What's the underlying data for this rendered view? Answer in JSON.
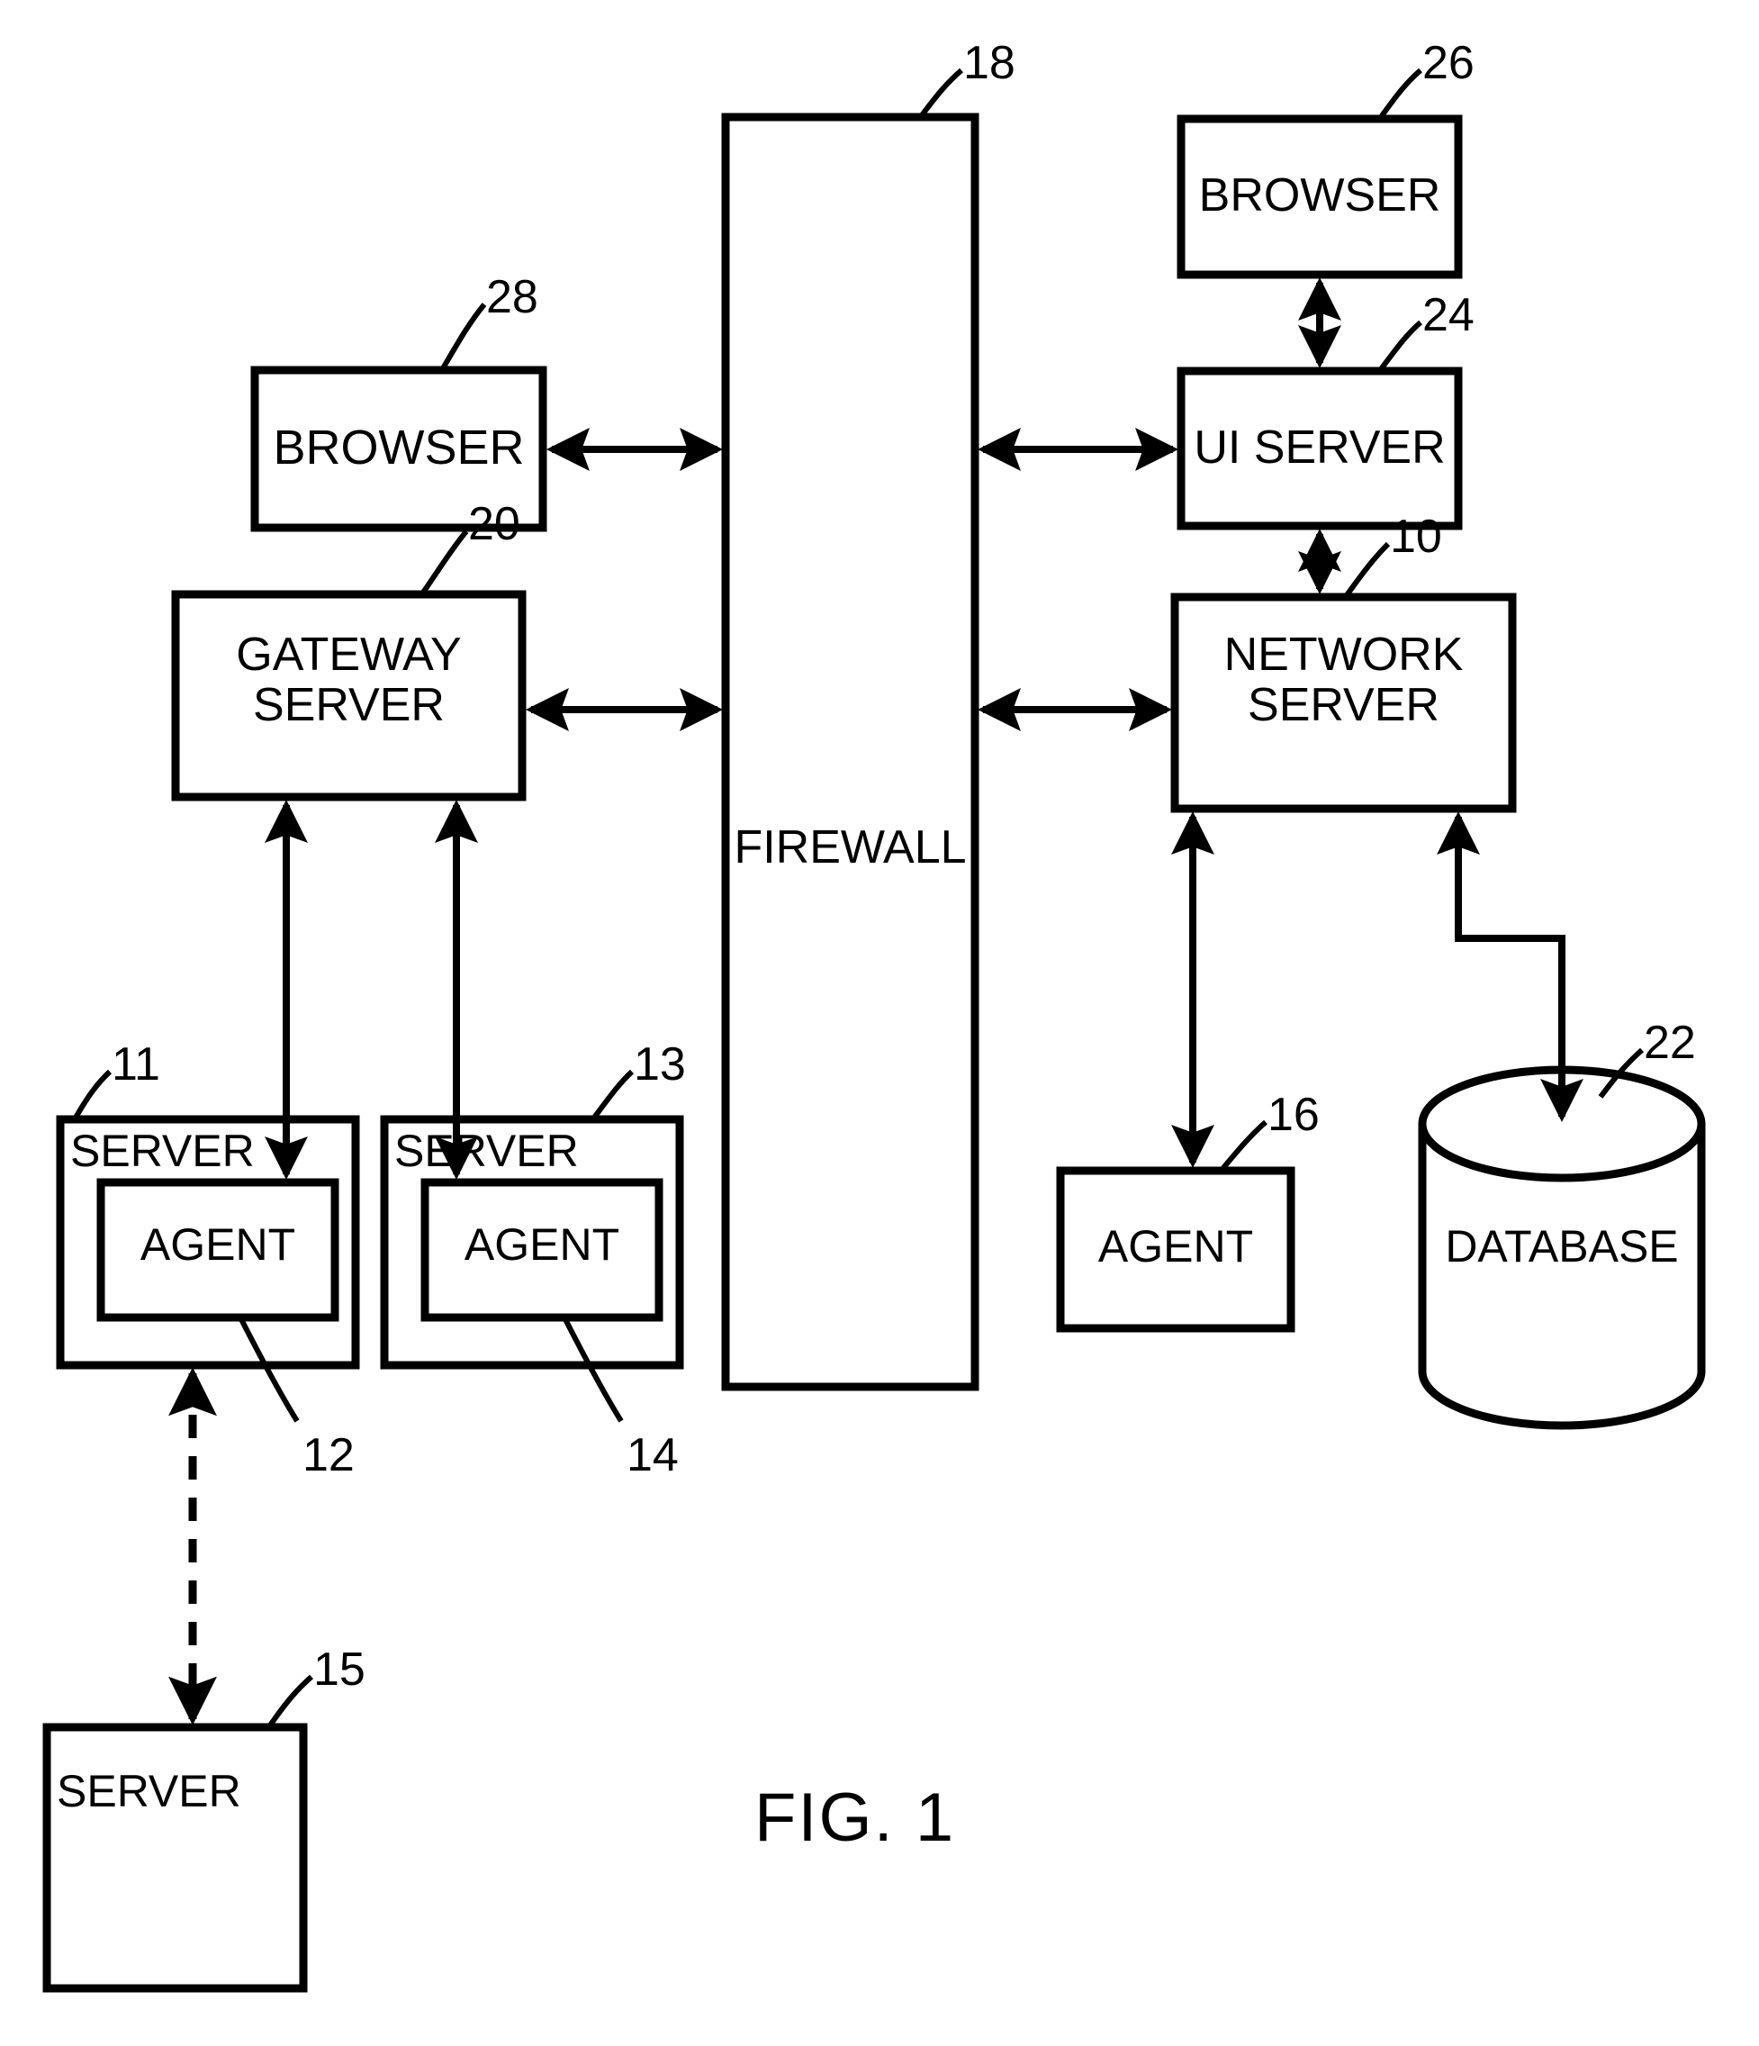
{
  "figure": {
    "caption": "FIG. 1",
    "title": "Network monitoring system block diagram"
  },
  "nodes": {
    "browser_left": {
      "label": "BROWSER",
      "ref": "28",
      "shape": "rectangle"
    },
    "gateway_server": {
      "label": "GATEWAY\nSERVER",
      "ref": "20",
      "shape": "rectangle"
    },
    "firewall": {
      "label": "FIREWALL",
      "ref": "18",
      "shape": "tall-rectangle"
    },
    "browser_right": {
      "label": "BROWSER",
      "ref": "26",
      "shape": "rectangle"
    },
    "ui_server": {
      "label": "UI SERVER",
      "ref": "24",
      "shape": "rectangle"
    },
    "network_server": {
      "label": "NETWORK\nSERVER",
      "ref": "10",
      "shape": "rectangle"
    },
    "server_11": {
      "label": "SERVER",
      "ref": "11",
      "shape": "rectangle"
    },
    "agent_12": {
      "label": "AGENT",
      "ref": "12",
      "shape": "rectangle"
    },
    "server_13": {
      "label": "SERVER",
      "ref": "13",
      "shape": "rectangle"
    },
    "agent_14": {
      "label": "AGENT",
      "ref": "14",
      "shape": "rectangle"
    },
    "agent_16": {
      "label": "AGENT",
      "ref": "16",
      "shape": "rectangle"
    },
    "database_22": {
      "label": "DATABASE",
      "ref": "22",
      "shape": "cylinder"
    },
    "server_15": {
      "label": "SERVER",
      "ref": "15",
      "shape": "rectangle"
    }
  },
  "connections": [
    {
      "from": "browser_left",
      "to": "firewall",
      "style": "solid",
      "arrows": "both"
    },
    {
      "from": "gateway_server",
      "to": "firewall",
      "style": "solid",
      "arrows": "both"
    },
    {
      "from": "firewall",
      "to": "ui_server",
      "style": "solid",
      "arrows": "both"
    },
    {
      "from": "firewall",
      "to": "network_server",
      "style": "solid",
      "arrows": "both"
    },
    {
      "from": "browser_right",
      "to": "ui_server",
      "style": "solid",
      "arrows": "both"
    },
    {
      "from": "ui_server",
      "to": "network_server",
      "style": "solid",
      "arrows": "both"
    },
    {
      "from": "gateway_server",
      "to": "agent_12",
      "style": "solid",
      "arrows": "both"
    },
    {
      "from": "gateway_server",
      "to": "agent_14",
      "style": "solid",
      "arrows": "both"
    },
    {
      "from": "network_server",
      "to": "agent_16",
      "style": "solid",
      "arrows": "both"
    },
    {
      "from": "network_server",
      "to": "database_22",
      "style": "solid",
      "arrows": "both"
    },
    {
      "from": "server_11",
      "to": "server_15",
      "style": "dashed",
      "arrows": "both"
    }
  ]
}
